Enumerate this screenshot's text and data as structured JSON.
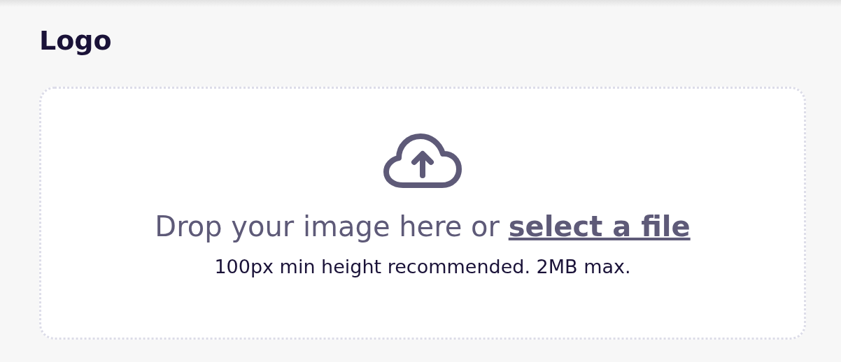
{
  "heading": "Logo",
  "dropzone": {
    "prompt": "Drop your image here or",
    "link": "select a file",
    "hint": "100px min height recommended. 2MB max."
  }
}
